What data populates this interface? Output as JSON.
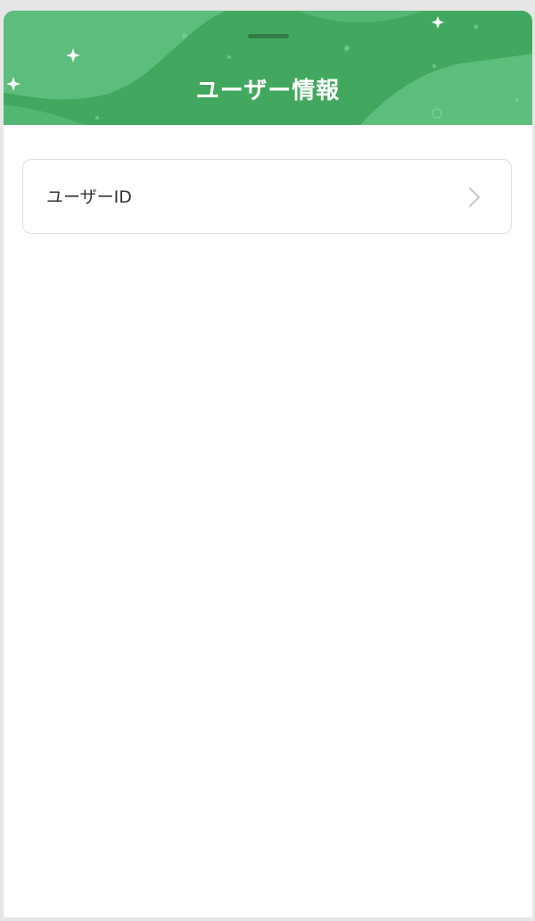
{
  "header": {
    "title": "ユーザー情報"
  },
  "list": {
    "items": [
      {
        "label": "ユーザーID"
      }
    ]
  },
  "colors": {
    "header_green": "#43a85f",
    "header_light_green": "#5fbf7f",
    "handle": "#2f7d45",
    "text": "#333333",
    "border": "#dedede"
  },
  "icons": {
    "list_item_trailing": "chevron-right-icon",
    "decorations": "sparkle-icon"
  }
}
